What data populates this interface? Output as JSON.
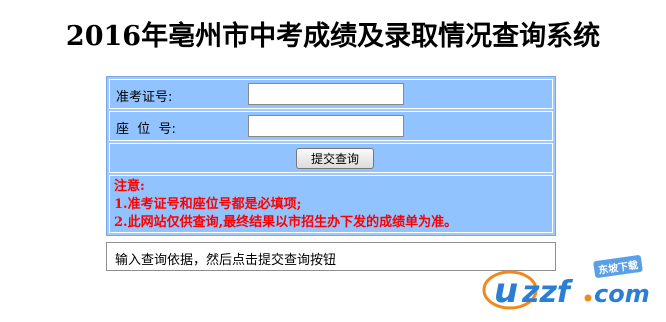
{
  "page": {
    "title": "2016年亳州市中考成绩及录取情况查询系统"
  },
  "form": {
    "exam_id_label": "准考证号:",
    "exam_id_value": "",
    "seat_label": "座  位  号:",
    "seat_value": "",
    "submit_label": "提交查询",
    "notice_title": "注意:",
    "notice_lines": [
      "1.准考证号和座位号都是必填项;",
      "2.此网站仅供查询,最终结果以市招生办下发的成绩单为准。"
    ]
  },
  "hint": {
    "text": "输入查询依据，然后点击提交查询按钮"
  },
  "watermark": {
    "badge": "东坡下载",
    "logo_text": "uzzf.com",
    "brand_color": "#2a7fd4",
    "accent_color": "#f08a1c"
  }
}
